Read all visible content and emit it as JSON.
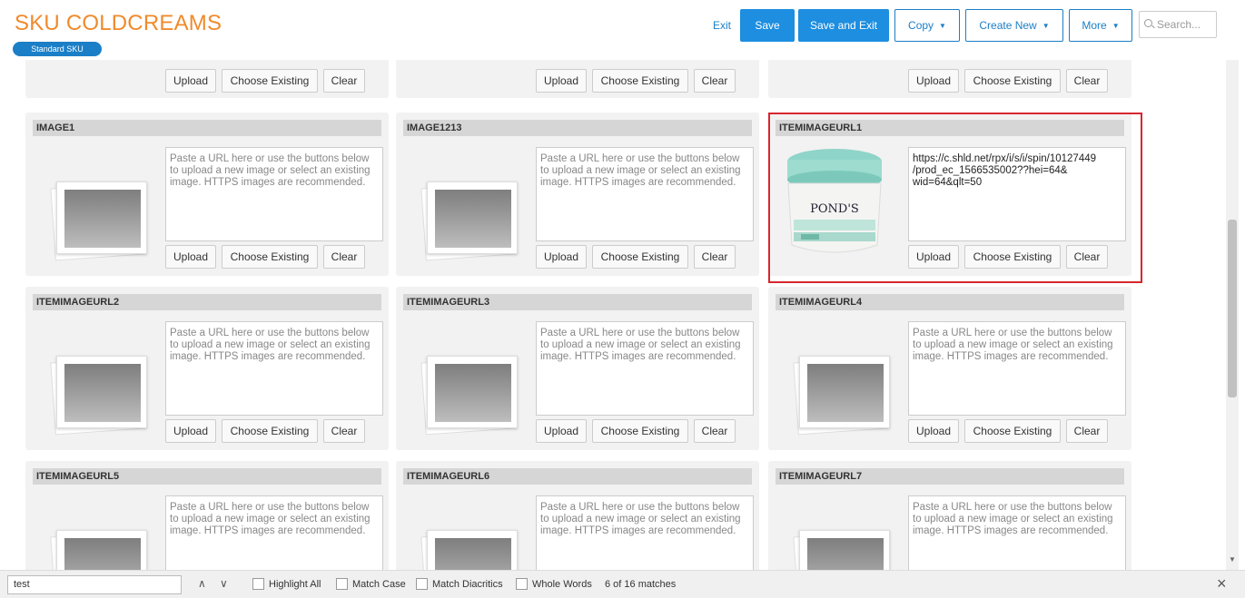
{
  "header": {
    "title": "SKU COLDCREAMS",
    "badge": "Standard SKU",
    "exit": "Exit",
    "save": "Save",
    "save_and_exit": "Save and Exit",
    "copy": "Copy",
    "create_new": "Create New",
    "more": "More",
    "search_placeholder": "Search..."
  },
  "buttons": {
    "upload": "Upload",
    "choose_existing": "Choose Existing",
    "clear": "Clear"
  },
  "placeholder_text": "Paste a URL here or use the buttons below to upload a new image or select an existing image. HTTPS images are recommended.",
  "cards": [
    {
      "title": "IMAGE1",
      "value": ""
    },
    {
      "title": "IMAGE1213",
      "value": ""
    },
    {
      "title": "ITEMIMAGEURL1",
      "value": "https://c.shld.net/rpx/i/s/i/spin/10127449 /prod_ec_1566535002??hei=64& wid=64&qlt=50",
      "highlighted": true
    },
    {
      "title": "ITEMIMAGEURL2",
      "value": ""
    },
    {
      "title": "ITEMIMAGEURL3",
      "value": ""
    },
    {
      "title": "ITEMIMAGEURL4",
      "value": ""
    },
    {
      "title": "ITEMIMAGEURL5",
      "value": ""
    },
    {
      "title": "ITEMIMAGEURL6",
      "value": ""
    },
    {
      "title": "ITEMIMAGEURL7",
      "value": ""
    }
  ],
  "product_image": {
    "brand": "POND'S"
  },
  "findbar": {
    "query": "test",
    "highlight_all": "Highlight All",
    "match_case": "Match Case",
    "match_diacritics": "Match Diacritics",
    "whole_words": "Whole Words",
    "matches": "6 of 16 matches"
  },
  "colors": {
    "accent": "#f08a2c",
    "primary": "#1d8ee0",
    "highlight": "#d7262e"
  }
}
